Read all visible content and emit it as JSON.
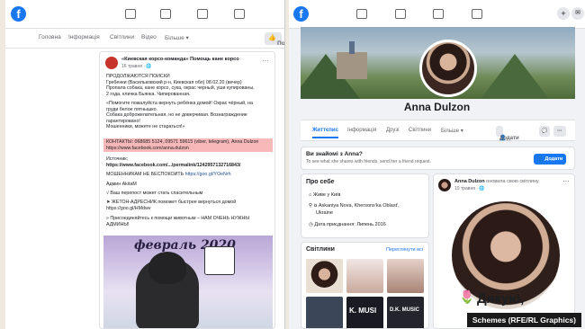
{
  "left": {
    "nav": {
      "items": [
        "Головна",
        "Інформація",
        "Світлини",
        "Відео",
        "Більше ▾"
      ],
      "share_label": "Поділитися"
    },
    "post": {
      "author": "«Киевская корсо-команда» Помощь кане корсо",
      "date": "16 травня · 🌐",
      "lines": [
        "ПРОДОЛЖАЮТСЯ ПОИСКИ",
        "Гребенки (Васильковский р-н, Киевская обл) 08.02.20 (вечер)",
        "Пропала собака, кане корсо, сука, окрас черный, уши купированы,",
        "2 года, кличка Бьянка. Чипированная.",
        "«Помогите пожалуйста вернуть ребёнка домой! Окрас чёрный, на",
        "груди белое пятнышко.",
        "Собака доброжелательная, но не доверчивая. Вознаграждение",
        "гарантировано!",
        "Мошенники, можете не стараться!»"
      ],
      "contacts_line1": "КОНТАКТЫ: 068685 5124, 09571 59615 (viber, telegram), Anna Dulzon",
      "contacts_line2": "https://www.facebook.com/anna.dulzon",
      "source_label": "Источник:",
      "source_link": "https://www.facebook.com/.../permalink/1242957132716843/",
      "scam_warn": "МОШЕННИКАМ НЕ БЕСПОКОИТЬ",
      "scam_link": "https://goo.gl/YOeNrh",
      "admin": "Админ AkitaM",
      "repost": "√ Ваш перепост может стать спасительным",
      "tag_line": "➤ ЖЕТОН-АДРЕСНИК поможет быстрее вернуться домой",
      "tag_link": "https://goo.gl/HMdwv",
      "join_line1": "» Присоединяйтесь к помощи животным – НАМ ОЧЕНЬ НУЖНЫ",
      "join_line2": "АДМИНЫ!",
      "image_caption": "февраль 2020"
    }
  },
  "right": {
    "profile_name": "Anna Dulzon",
    "tabs": [
      "Життєпис",
      "Інформація",
      "Друзі",
      "Світлини",
      "Більше ▾"
    ],
    "add_friend_label": "Додати друга",
    "know_title": "Ви знайомі з Anna?",
    "know_sub": "To see what she shares with friends, send her a friend request.",
    "know_add_label": "Додати",
    "intro_title": "Про себе",
    "intro_rows": [
      "Живе у Київ",
      "із Askaniya Nova, Khersonsʹka Oblastʹ,",
      "Ukraine",
      "Дата приєднання: Липень 2016"
    ],
    "photos_title": "Світлини",
    "photos_link": "Переглянути всі",
    "photo_text_1": "K. MUSI",
    "photo_text_2": "D.K. MUSIC",
    "post_author": "Anna Dulzon",
    "post_action": "оновила свою світлину",
    "post_date": "10 травня · 🌐",
    "post_overlay": "Дякую,"
  },
  "credit": "Schemes (RFE/RL Graphics)"
}
